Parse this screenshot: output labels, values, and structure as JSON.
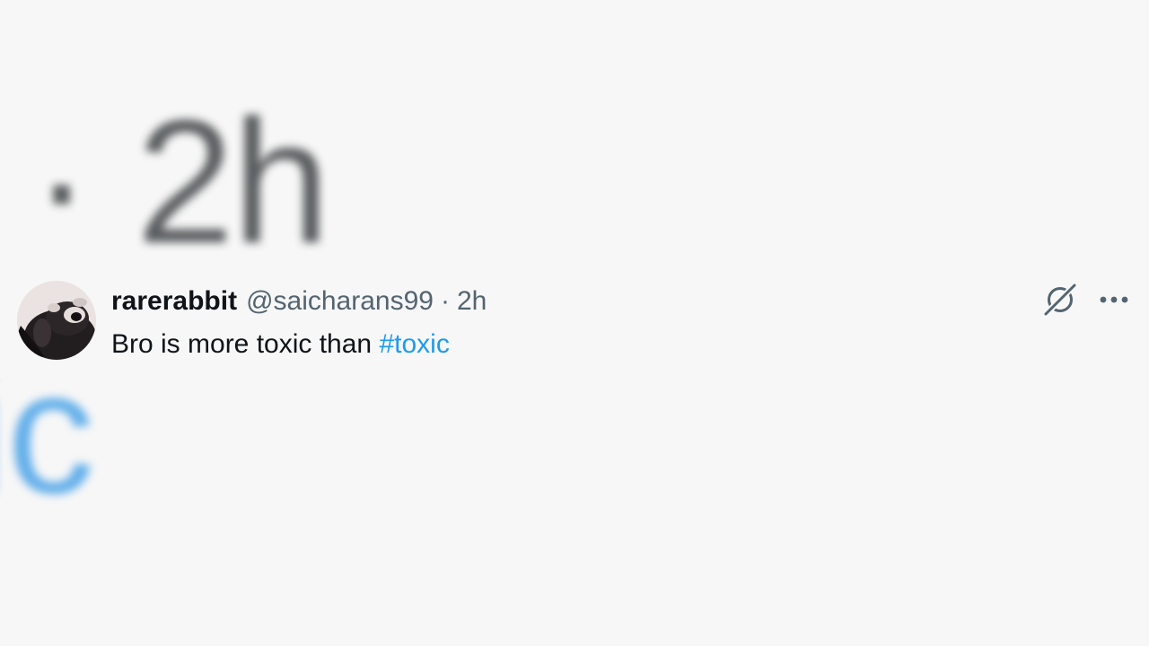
{
  "background": {
    "zoomed_time": "· 2h",
    "zoomed_hashtag_fragment": "ic"
  },
  "tweet": {
    "display_name": "rarerabbit",
    "handle": "@saicharans99",
    "separator": "·",
    "time_ago": "2h",
    "text_before_hashtag": "Bro is more toxic than ",
    "hashtag": "#toxic"
  },
  "icons": {
    "grok": "grok-icon",
    "more": "more-options-icon",
    "avatar": "raccoon-avatar"
  },
  "colors": {
    "background": "#f7f7f7",
    "primary_text": "#0f1419",
    "secondary_text": "#536471",
    "hashtag": "#1d9bf0"
  }
}
